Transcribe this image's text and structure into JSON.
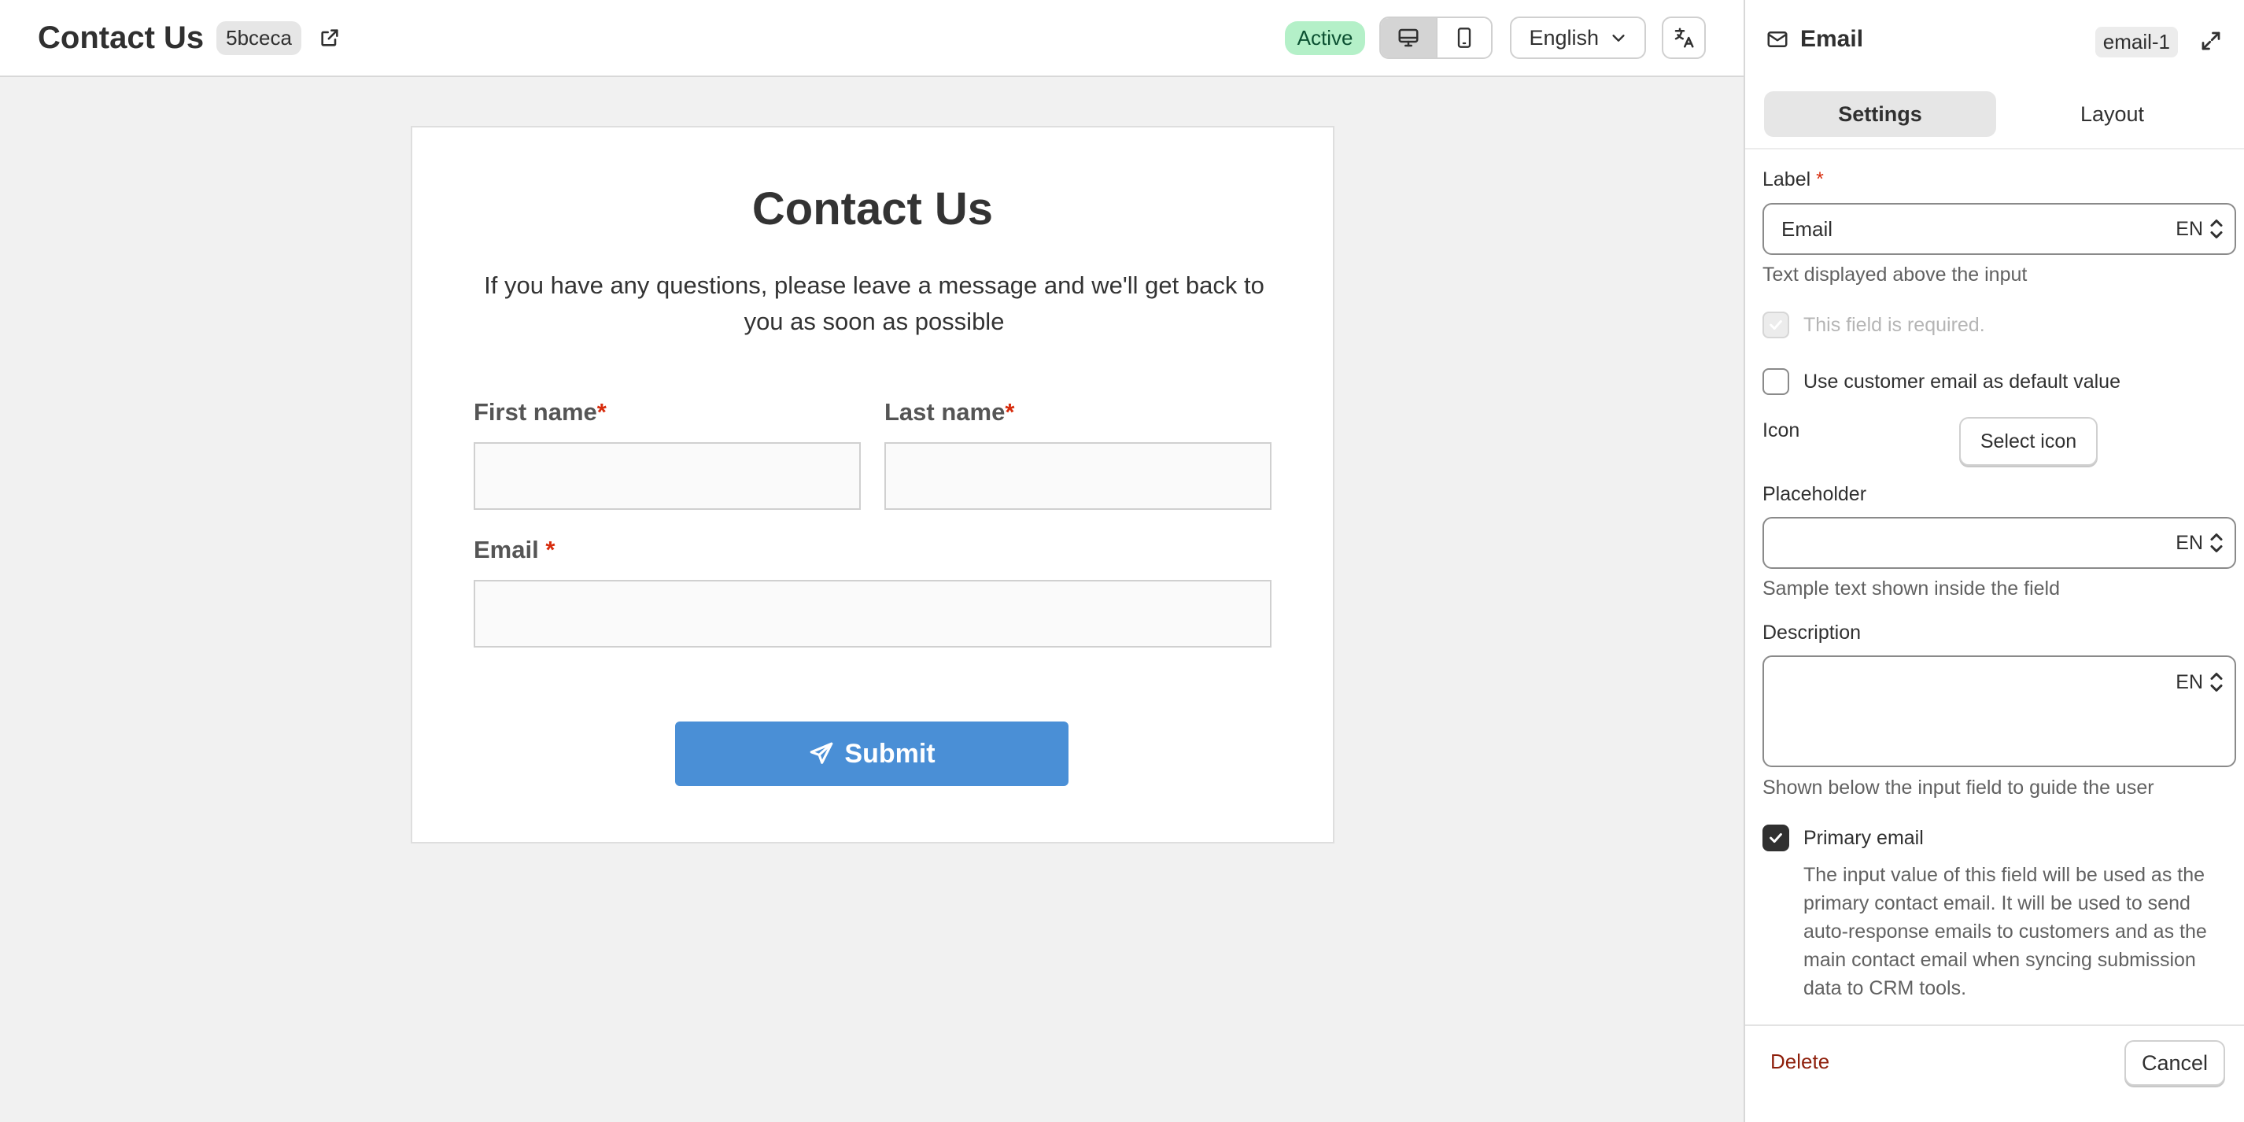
{
  "header": {
    "title": "Contact Us",
    "id_badge": "5bceca",
    "status": "Active",
    "language": "English",
    "icons": {
      "open": "external-link-icon",
      "desktop": "desktop-icon",
      "mobile": "mobile-icon",
      "language": "chevron-down-icon",
      "translate": "translate-icon"
    }
  },
  "form": {
    "title": "Contact Us",
    "description": "If you have any questions, please leave a message and we'll get back to you as soon as possible",
    "fields": {
      "first_name": {
        "label": "First name",
        "required_mark": "*",
        "value": ""
      },
      "last_name": {
        "label": "Last name",
        "required_mark": "*",
        "value": ""
      },
      "email": {
        "label": "Email",
        "required_mark": "*",
        "value": ""
      }
    },
    "submit_label": "Submit",
    "submit_icon": "send-icon"
  },
  "panel": {
    "title": "Email",
    "title_icon": "email-icon",
    "id_badge": "email-1",
    "tabs": [
      "Settings",
      "Layout"
    ],
    "active_tab": "Settings",
    "label_field": {
      "label": "Label",
      "required_mark": "*",
      "value": "Email",
      "lang": "EN",
      "help": "Text displayed above the input"
    },
    "required_checkbox": {
      "label": "This field is required.",
      "checked": true,
      "disabled": true
    },
    "customer_email_checkbox": {
      "label": "Use customer email as default value",
      "checked": false
    },
    "icon_row": {
      "label": "Icon",
      "button": "Select icon"
    },
    "placeholder_field": {
      "label": "Placeholder",
      "value": "",
      "lang": "EN",
      "help": "Sample text shown inside the field"
    },
    "description_field": {
      "label": "Description",
      "value": "",
      "lang": "EN",
      "help": "Shown below the input field to guide the user"
    },
    "primary_email": {
      "label": "Primary email",
      "checked": true,
      "note": "The input value of this field will be used as the primary contact email. It will be used to send auto-response emails to customers and as the main contact email when syncing submission data to CRM tools."
    },
    "footer": {
      "delete": "Delete",
      "cancel": "Cancel"
    }
  },
  "colors": {
    "accent": "#4a8fd6",
    "active_badge": "#b4f0c8",
    "required": "#d72c0d",
    "delete": "#8e1f0b"
  }
}
